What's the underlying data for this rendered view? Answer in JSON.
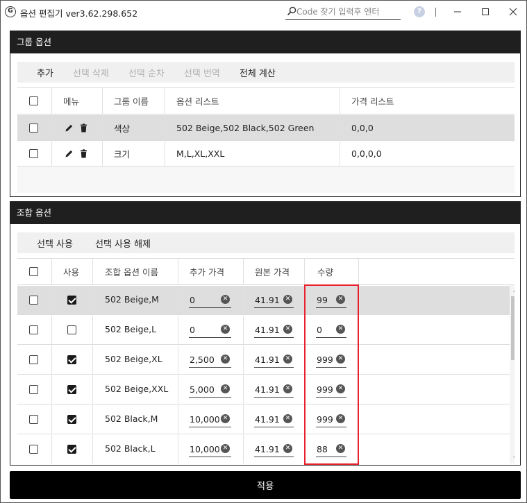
{
  "app": {
    "title": "옵션 편집기 ver3.62.298.652",
    "icon_letter": "G"
  },
  "search": {
    "placeholder": "Code 찾기 입력후 엔터",
    "value": ""
  },
  "titlebar_icons": {
    "help": "?"
  },
  "group_panel": {
    "title": "그룹 옵션",
    "toolbar": [
      {
        "label": "추가",
        "enabled": true
      },
      {
        "label": "선택 삭제",
        "enabled": false
      },
      {
        "label": "선택 순차",
        "enabled": false
      },
      {
        "label": "선택 번역",
        "enabled": false
      },
      {
        "label": "전체 계산",
        "enabled": true
      }
    ],
    "columns": {
      "menu": "메뉴",
      "group_name": "그룹 이름",
      "option_list": "옵션 리스트",
      "price_list": "가격 리스트"
    },
    "rows": [
      {
        "checked": false,
        "group_name": "색상",
        "option_list": "502 Beige,502 Black,502 Green",
        "price_list": "0,0,0",
        "selected": true
      },
      {
        "checked": false,
        "group_name": "크기",
        "option_list": "M,L,XL,XXL",
        "price_list": "0,0,0,0",
        "selected": false
      }
    ]
  },
  "combo_panel": {
    "title": "조합 옵션",
    "toolbar": [
      {
        "label": "선택 사용",
        "enabled": true
      },
      {
        "label": "선택 사용 해제",
        "enabled": true
      }
    ],
    "columns": {
      "use": "사용",
      "combo_name": "조합 옵션 이름",
      "extra_price": "추가 가격",
      "original_price": "원본 가격",
      "quantity": "수량"
    },
    "rows": [
      {
        "checked": false,
        "use": true,
        "name": "502 Beige,M",
        "extra_price": "0",
        "original_price": "41.91",
        "quantity": "99",
        "selected": true
      },
      {
        "checked": false,
        "use": false,
        "name": "502 Beige,L",
        "extra_price": "0",
        "original_price": "41.91",
        "quantity": "0",
        "selected": false
      },
      {
        "checked": false,
        "use": true,
        "name": "502 Beige,XL",
        "extra_price": "2,500",
        "original_price": "41.91",
        "quantity": "999",
        "selected": false
      },
      {
        "checked": false,
        "use": true,
        "name": "502 Beige,XXL",
        "extra_price": "5,000",
        "original_price": "41.91",
        "quantity": "999",
        "selected": false
      },
      {
        "checked": false,
        "use": true,
        "name": "502 Black,M",
        "extra_price": "10,000",
        "original_price": "41.91",
        "quantity": "999",
        "selected": false
      },
      {
        "checked": false,
        "use": true,
        "name": "502 Black,L",
        "extra_price": "10,000",
        "original_price": "41.91",
        "quantity": "88",
        "selected": false
      }
    ]
  },
  "apply_button": {
    "label": "적용"
  },
  "colors": {
    "header_bg": "#1f1f1f",
    "highlight": "#e8202c",
    "selected_row": "#dedede"
  }
}
